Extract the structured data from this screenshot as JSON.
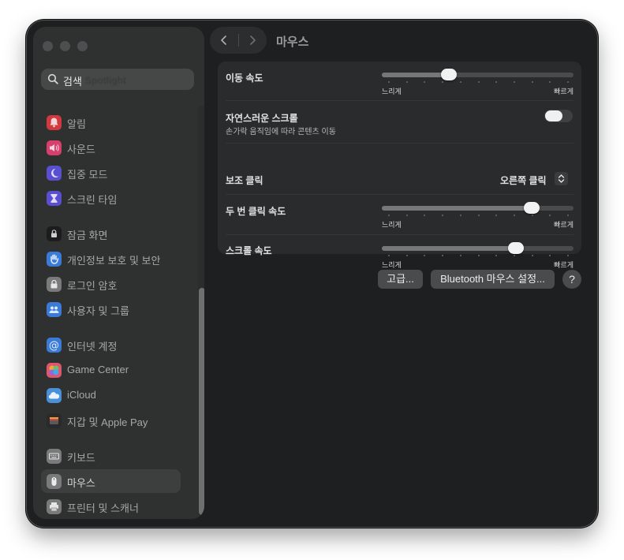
{
  "window": {
    "title": "마우스"
  },
  "search": {
    "placeholder": "검색",
    "ghost_text": "Spotlight"
  },
  "sidebar": {
    "items": [
      {
        "label": "알림",
        "icon": "bell-icon",
        "color": "#d0393f"
      },
      {
        "label": "사운드",
        "icon": "speaker-icon",
        "color": "#d83f6c"
      },
      {
        "label": "집중 모드",
        "icon": "moon-icon",
        "color": "#5a4fd0"
      },
      {
        "label": "스크린 타임",
        "icon": "hourglass-icon",
        "color": "#5a4fd0"
      },
      {
        "label": "잠금 화면",
        "icon": "lock-screen-icon",
        "color": "#1c1c1e"
      },
      {
        "label": "개인정보 보호 및 보안",
        "icon": "hand-icon",
        "color": "#3b7bd8"
      },
      {
        "label": "로그인 암호",
        "icon": "lock-icon",
        "color": "#7a7a7c"
      },
      {
        "label": "사용자 및 그룹",
        "icon": "users-icon",
        "color": "#3b7bd8"
      },
      {
        "label": "인터넷 계정",
        "icon": "at-icon",
        "color": "#3b7bd8"
      },
      {
        "label": "Game Center",
        "icon": "game-center-icon",
        "color": "#e0566e"
      },
      {
        "label": "iCloud",
        "icon": "cloud-icon",
        "color": "#4a90d9"
      },
      {
        "label": "지갑 및 Apple Pay",
        "icon": "wallet-icon",
        "color": "#2a2a2c"
      },
      {
        "label": "키보드",
        "icon": "keyboard-icon",
        "color": "#7a7a7c"
      },
      {
        "label": "마우스",
        "icon": "mouse-icon",
        "color": "#7a7a7c",
        "selected": true
      },
      {
        "label": "프린터 및 스캐너",
        "icon": "printer-icon",
        "color": "#7a7a7c"
      }
    ]
  },
  "settings": {
    "tracking_speed": {
      "label": "이동 속도",
      "min_label": "느리게",
      "max_label": "빠르게",
      "value": 0.35
    },
    "natural_scroll": {
      "label": "자연스러운 스크롤",
      "description": "손가락 움직임에 따라 콘텐츠 이동",
      "enabled": false
    },
    "secondary_click": {
      "label": "보조 클릭",
      "value": "오른쪽 클릭"
    },
    "double_click_speed": {
      "label": "두 번 클릭 속도",
      "min_label": "느리게",
      "max_label": "빠르게",
      "value": 0.78
    },
    "scroll_speed": {
      "label": "스크롤 속도",
      "min_label": "느리게",
      "max_label": "빠르게",
      "value": 0.7
    }
  },
  "buttons": {
    "advanced": "고급...",
    "bluetooth": "Bluetooth 마우스 설정...",
    "help": "?"
  }
}
